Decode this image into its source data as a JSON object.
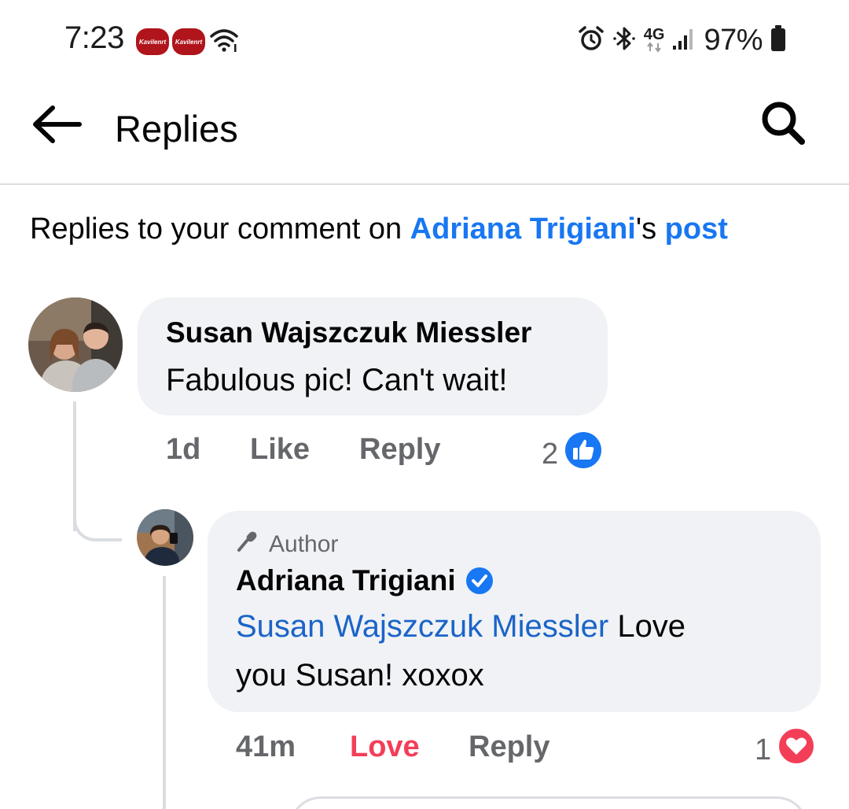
{
  "status_bar": {
    "time": "7:23",
    "notification_badges": [
      "Kavilenrt",
      "Kavilenrt"
    ],
    "network_label": "4G",
    "battery_percent": "97%",
    "icons": [
      "alarm-icon",
      "bluetooth-icon",
      "wifi-icon",
      "signal-icon",
      "battery-icon"
    ]
  },
  "app_bar": {
    "title": "Replies",
    "back_icon": "arrow-left-icon",
    "search_icon": "search-icon"
  },
  "context": {
    "prefix": "Replies to your comment on ",
    "page_name": "Adriana Trigiani",
    "possessive": "'s ",
    "post_label": "post"
  },
  "comments": [
    {
      "author": "Susan Wajszczuk Miessler",
      "text": "Fabulous pic! Can't wait!",
      "time": "1d",
      "like_label": "Like",
      "reply_label": "Reply",
      "reaction_count": "2",
      "reaction_type": "like"
    },
    {
      "badge": "Author",
      "author": "Adriana Trigiani",
      "verified": true,
      "mention": "Susan Wajszczuk Miessler",
      "text_line1": " Love",
      "text_line2": "you Susan! xoxox",
      "time": "41m",
      "like_label": "Love",
      "reply_label": "Reply",
      "reaction_count": "1",
      "reaction_type": "love"
    }
  ],
  "colors": {
    "link_blue": "#1877f2",
    "mention_blue": "#1b64c8",
    "love_red": "#f33e58",
    "bubble_bg": "#f0f2f5",
    "meta_gray": "#65676b"
  }
}
